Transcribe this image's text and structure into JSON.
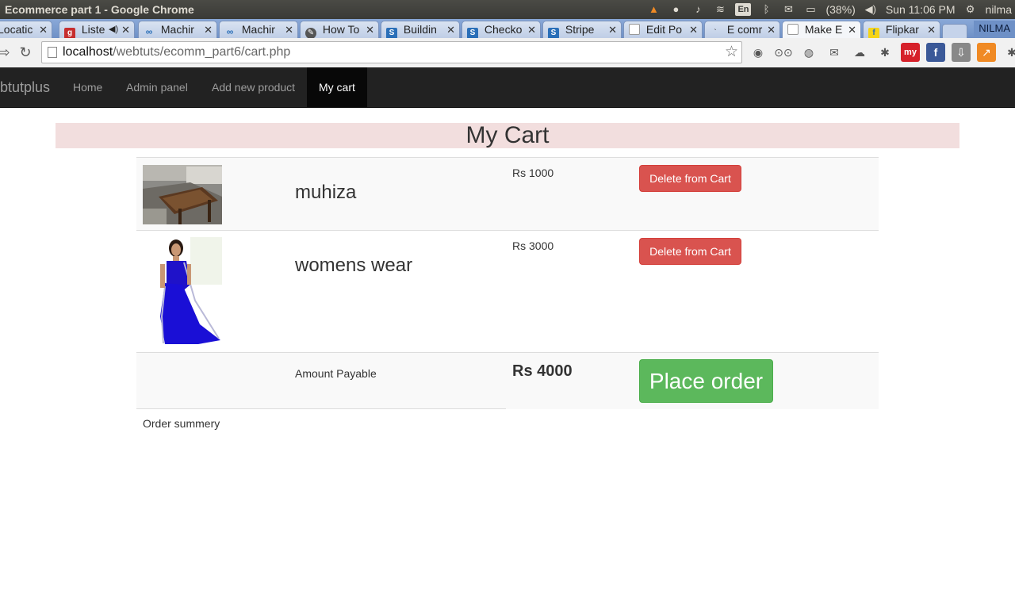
{
  "os": {
    "window_title": "Ecommerce part 1 - Google Chrome",
    "tray": {
      "battery": "(38%)",
      "clock": "Sun 11:06 PM",
      "user": "nilma",
      "language": "En"
    }
  },
  "browser": {
    "tabs": [
      {
        "label": "Locatic",
        "icon": "page"
      },
      {
        "label": "Liste",
        "icon": "g"
      },
      {
        "label": "Machir",
        "icon": "co"
      },
      {
        "label": "Machir",
        "icon": "co"
      },
      {
        "label": "How To",
        "icon": "how"
      },
      {
        "label": "Buildin",
        "icon": "s"
      },
      {
        "label": "Checko",
        "icon": "s"
      },
      {
        "label": "Stripe",
        "icon": "s"
      },
      {
        "label": "Edit Po",
        "icon": "doc"
      },
      {
        "label": "E comr",
        "icon": "e"
      },
      {
        "label": "Make E",
        "icon": "doc",
        "active": true
      },
      {
        "label": "Flipkar",
        "icon": "flipkart"
      }
    ],
    "profile_name": "NILMA",
    "url": {
      "host": "localhost",
      "path": "/webtuts/ecomm_part6/cart.php"
    }
  },
  "site": {
    "brand": "btutplus",
    "nav": [
      {
        "label": "Home"
      },
      {
        "label": "Admin panel"
      },
      {
        "label": "Add new product"
      },
      {
        "label": "My cart",
        "active": true
      }
    ]
  },
  "cart": {
    "heading": "My Cart",
    "items": [
      {
        "name": "muhiza",
        "price": "Rs 1000",
        "action": "Delete from Cart"
      },
      {
        "name": "womens wear",
        "price": "Rs 3000",
        "action": "Delete from Cart"
      }
    ],
    "total": {
      "label": "Amount Payable",
      "value": "Rs 4000",
      "action": "Place order"
    },
    "summary_label": "Order summery"
  },
  "colors": {
    "heading_bg": "#f2dede",
    "danger": "#d9534f",
    "success": "#5cb85c",
    "navbar": "#222222"
  }
}
